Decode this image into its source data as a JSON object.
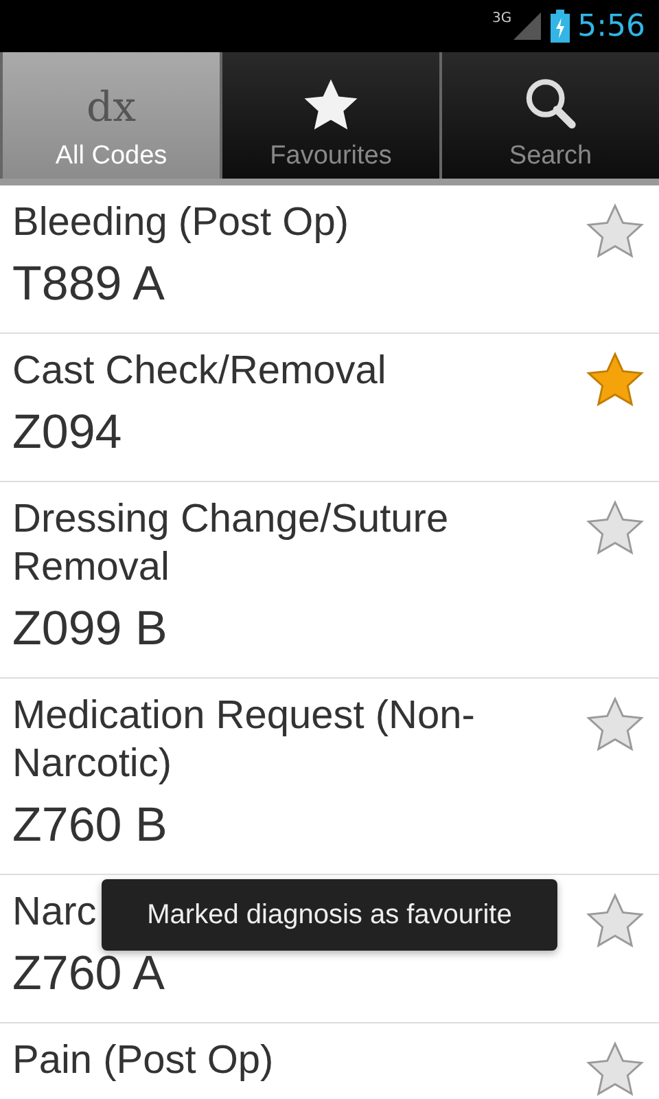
{
  "status_bar": {
    "network": "3G",
    "time": "5:56"
  },
  "tabs": [
    {
      "label": "All Codes",
      "kind": "logo",
      "glyph": "dx",
      "selected": true
    },
    {
      "label": "Favourites",
      "kind": "star",
      "selected": false
    },
    {
      "label": "Search",
      "kind": "search",
      "selected": false
    }
  ],
  "codes": [
    {
      "title": "Bleeding (Post Op)",
      "code": "T889 A",
      "favourite": false
    },
    {
      "title": "Cast Check/Removal",
      "code": "Z094",
      "favourite": true
    },
    {
      "title": "Dressing Change/Suture Removal",
      "code": "Z099 B",
      "favourite": false
    },
    {
      "title": "Medication Request (Non-Narcotic)",
      "code": "Z760 B",
      "favourite": false
    },
    {
      "title": "Narc",
      "code": "Z760 A",
      "favourite": false
    },
    {
      "title": "Pain (Post Op)",
      "favourite": false
    }
  ],
  "toast": {
    "message": "Marked diagnosis as favourite"
  }
}
